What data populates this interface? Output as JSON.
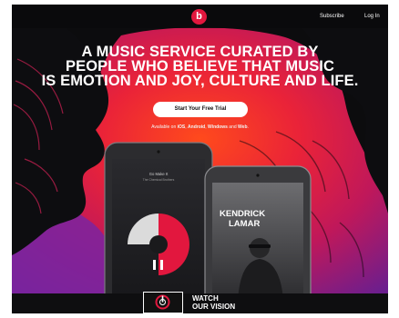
{
  "header": {
    "logo_letter": "b",
    "subscribe_label": "Subscribe",
    "login_label": "Log In"
  },
  "hero": {
    "headline_lines": [
      "A MUSIC SERVICE CURATED BY",
      "PEOPLE WHO BELIEVE THAT MUSIC",
      "IS EMOTION AND JOY, CULTURE AND LIFE."
    ],
    "cta_label": "Start Your Free Trial",
    "availability_prefix": "Available on ",
    "platforms": [
      "iOS",
      "Android",
      "Windows",
      "Web"
    ],
    "availability_sep1": ", ",
    "availability_sep2": ", ",
    "availability_sep3": " and ",
    "availability_suffix": "."
  },
  "phone_left": {
    "now_playing_title": "Go Make It",
    "now_playing_artist": "The Chemical Brothers"
  },
  "phone_right": {
    "artist_name_line1": "KENDRICK",
    "artist_name_line2": "LAMAR"
  },
  "footer": {
    "watch_label_line1": "WATCH",
    "watch_label_line2": "OUR VISION"
  },
  "colors": {
    "brand_red": "#e2173e",
    "hero_magenta": "#c0185a",
    "hero_purple": "#6b1e8e"
  }
}
